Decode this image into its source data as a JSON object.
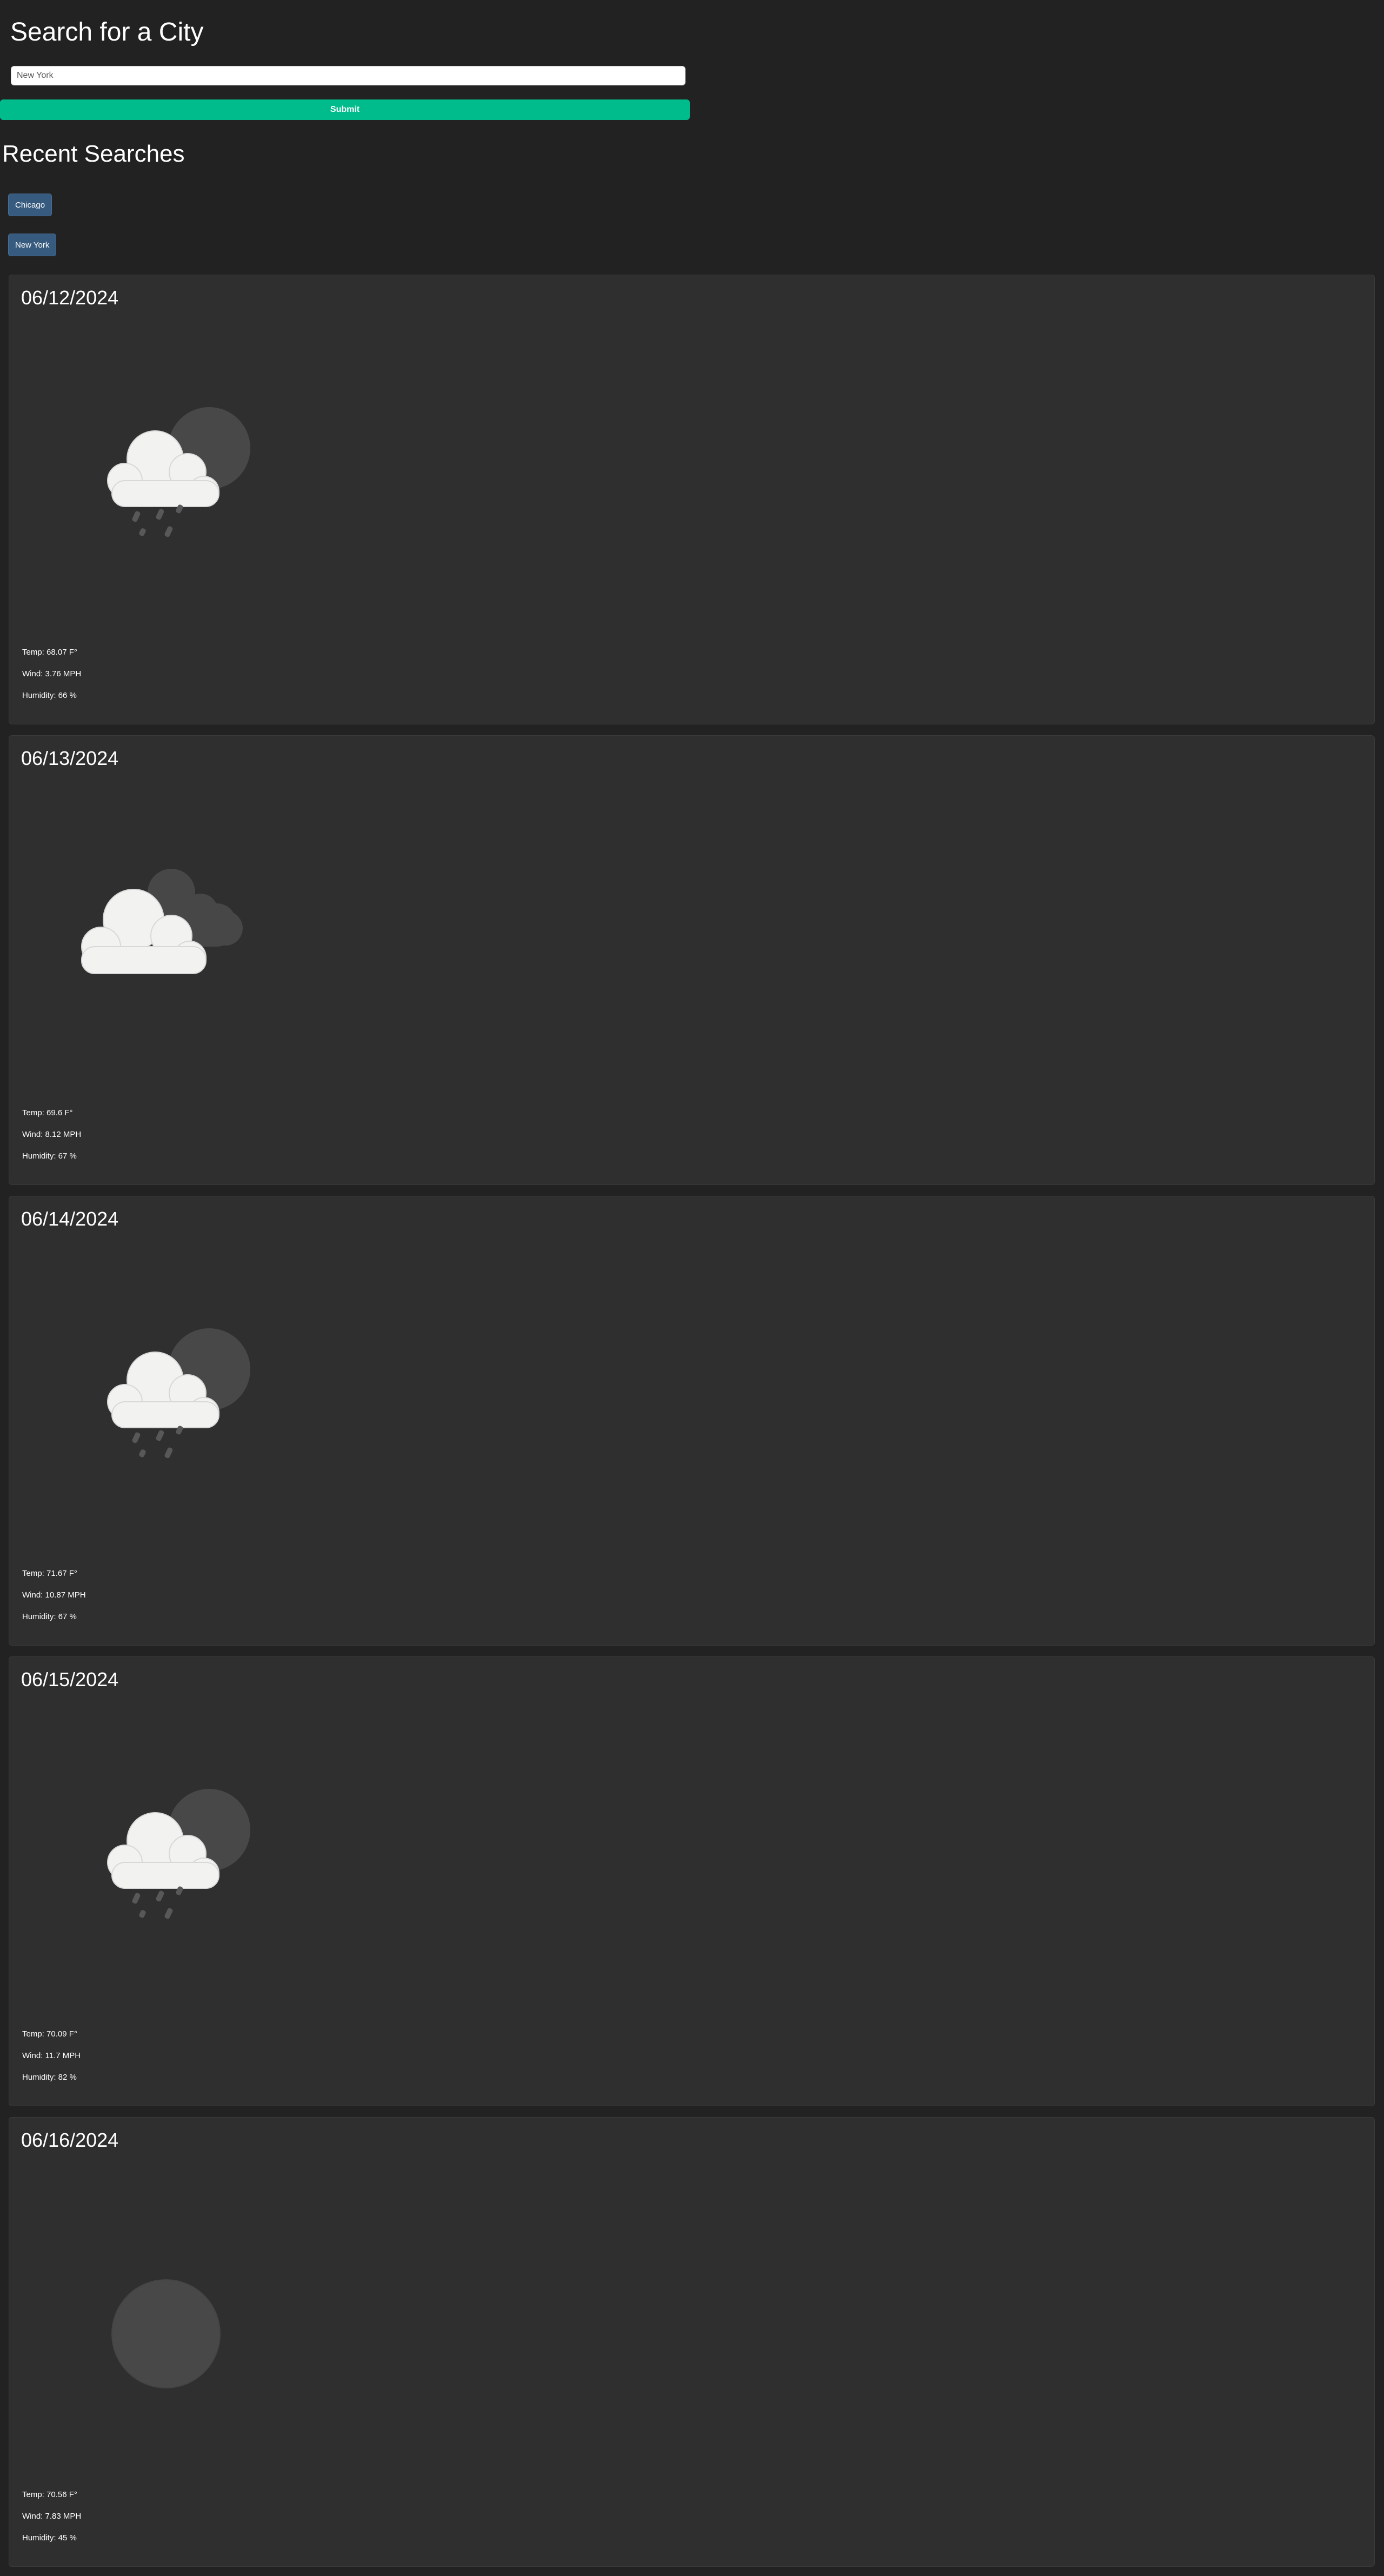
{
  "search": {
    "title": "Search for a City",
    "input_value": "New York",
    "submit_label": "Submit"
  },
  "recent": {
    "title": "Recent Searches",
    "items": [
      "Chicago",
      "New York"
    ]
  },
  "forecast": [
    {
      "date": "06/12/2024",
      "icon": "rain-cloud-moon-icon",
      "temp": "Temp: 68.07 F°",
      "wind": "Wind: 3.76 MPH",
      "humidity": "Humidity: 66 %"
    },
    {
      "date": "06/13/2024",
      "icon": "broken-clouds-icon",
      "temp": "Temp: 69.6 F°",
      "wind": "Wind: 8.12 MPH",
      "humidity": "Humidity: 67 %"
    },
    {
      "date": "06/14/2024",
      "icon": "rain-cloud-moon-icon",
      "temp": "Temp: 71.67 F°",
      "wind": "Wind: 10.87 MPH",
      "humidity": "Humidity: 67 %"
    },
    {
      "date": "06/15/2024",
      "icon": "rain-cloud-moon-icon",
      "temp": "Temp: 70.09 F°",
      "wind": "Wind: 11.7 MPH",
      "humidity": "Humidity: 82 %"
    },
    {
      "date": "06/16/2024",
      "icon": "clear-moon-icon",
      "temp": "Temp: 70.56 F°",
      "wind": "Wind: 7.83 MPH",
      "humidity": "Humidity: 45 %"
    }
  ],
  "colors": {
    "background": "#222222",
    "card": "#2f2f2f",
    "accent": "#00bc8c",
    "recent_button": "#375a7f"
  }
}
